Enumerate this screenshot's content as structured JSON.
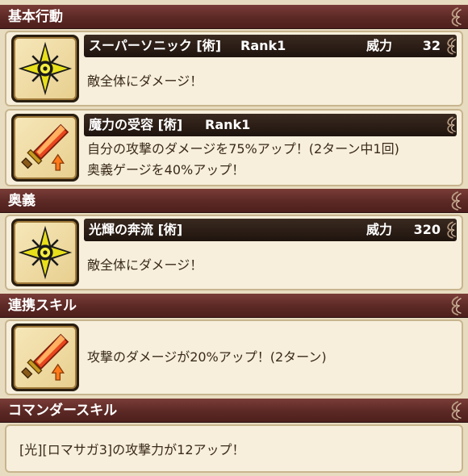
{
  "sections": {
    "basic": {
      "title": "基本行動"
    },
    "ougi": {
      "title": "奥義"
    },
    "renkei": {
      "title": "連携スキル"
    },
    "commander": {
      "title": "コマンダースキル"
    }
  },
  "skills": [
    {
      "name": "スーパーソニック [術]",
      "rank": "Rank1",
      "power_label": "威力",
      "power_value": "32",
      "icon": "star-burst-icon",
      "desc": [
        "敵全体にダメージ！"
      ]
    },
    {
      "name": "魔力の受容 [術]",
      "rank": "Rank1",
      "icon": "sword-up-icon",
      "desc": [
        "自分の攻撃のダメージを75%アップ！(2ターン中1回)",
        "奥義ゲージを40%アップ！"
      ]
    },
    {
      "name": "光輝の奔流 [術]",
      "power_label": "威力",
      "power_value": "320",
      "icon": "star-burst-icon",
      "desc": [
        "敵全体にダメージ！"
      ]
    }
  ],
  "renkei": {
    "icon": "sword-up-icon",
    "desc": "攻撃のダメージが20%アップ！(2ターン)"
  },
  "commander": {
    "desc": "[光][ロマサガ3]の攻撃力が12アップ！"
  },
  "colors": {
    "header": "#5e2a26",
    "bar": "#1f140e",
    "card_bg": "#f7efdc",
    "page_bg": "#e8dcc0"
  }
}
